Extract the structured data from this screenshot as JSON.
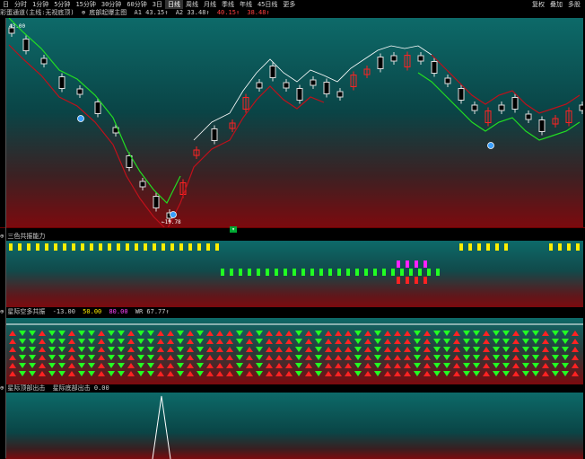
{
  "toolbar": {
    "timeframes": [
      "日",
      "分时",
      "1分钟",
      "5分钟",
      "15分钟",
      "30分钟",
      "60分钟",
      "3日",
      "日线",
      "周线",
      "月线",
      "季线",
      "年线",
      "45日线",
      "更多"
    ],
    "active_index": 8,
    "right_items": [
      "复权",
      "叠加",
      "多股"
    ]
  },
  "main_panel": {
    "header_parts": [
      "彩蛋通道(主线:无视底顶)",
      "⊕ 底部起爆主图",
      "A1 43.15↑",
      "A2 33.48↑",
      "40.15↑",
      "38.48↑"
    ],
    "price_high_label": "43.00",
    "price_low_label": "←19.78"
  },
  "panel2": {
    "header": "⊕ 三色共振能力"
  },
  "panel3": {
    "header_parts": [
      "⊕ 星际空多共振",
      "-13.00",
      "50.00",
      "80.00",
      "WR 67.77↑"
    ]
  },
  "panel4": {
    "header_parts": [
      "⊕ 星际顶部出击",
      "星际底部出击 0.00"
    ]
  },
  "colors": {
    "up": "#ff2222",
    "down": "#22ff22",
    "line_red": "#c0101a",
    "line_green": "#22dd22",
    "yellow": "#ffee00",
    "magenta": "#ff22ff",
    "header_value": "#ff4040"
  }
}
